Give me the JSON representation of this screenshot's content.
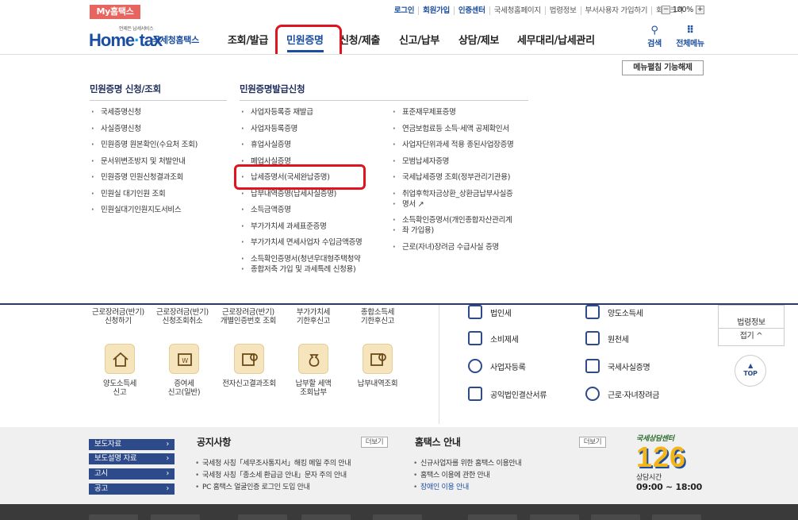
{
  "top": {
    "my_hometax": "My홈택스",
    "links": [
      "로그인",
      "회원가입",
      "인증센터",
      "국세청홈페이지",
      "법령정보",
      "부서사용자 가입하기",
      "화면크기"
    ],
    "zoom_minus": "−",
    "zoom_value": "100%",
    "zoom_plus": "+"
  },
  "logo": {
    "home": "Home",
    "tax": "tax",
    "korean": "국세청홈택스",
    "tiny": "언제든 납세서비스"
  },
  "gnb": {
    "items": [
      "조회/발급",
      "민원증명",
      "신청/제출",
      "신고/납부",
      "상담/제보",
      "세무대리/납세관리"
    ],
    "search": "검색",
    "all_menu": "전체메뉴"
  },
  "mega": {
    "fix_button": "메뉴펼침 기능해제",
    "col1_title": "민원증명 신청/조회",
    "col1_items": [
      "국세증명신청",
      "사실증명신청",
      "민원증명 원본확인(수요처 조회)",
      "문서위변조방지 및 처발안내",
      "민원증명 민원신청결과조회",
      "민원실 대기인원 조회",
      "민원실대기인원지도서비스"
    ],
    "col2_title": "민원증명발급신청",
    "col2_items": [
      "사업자등록증 재발급",
      "사업자등록증명",
      "휴업사실증명",
      "폐업사실증명",
      "납세증명서(국세완납증명)",
      "납부내역증명(납세사실증명)",
      "소득금액증명",
      "부가가치세 과세표준증명",
      "부가가치세 면세사업자 수입금액증명",
      "소득확인증명서(청년우대형주택청약",
      "종합저축 가입 및 과세특례 신청용)"
    ],
    "col3_items": [
      "표준재무제표증명",
      "연금보험료등 소득·세액 공제확인서",
      "사업자단위과세 적용 종된사업장증명",
      "모범납세자증명",
      "국세납세증명 조회(정부관리기관용)",
      "취업후학자금상환_상환금납부사실증",
      "명서",
      "소득확인증명서(개인종합자산관리계",
      "좌 가입용)",
      "근로(자녀)장려금 수급사실 증명"
    ]
  },
  "quick": {
    "row1": [
      "근로장려금(반기)",
      "신청하기",
      "근로장려금(반기)",
      "신청조회취소",
      "근로장려금(반기)",
      "개별인증번호 조회",
      "부가가치세",
      "기한후신고",
      "종합소득세",
      "기한후신고"
    ],
    "row2": [
      "양도소득세",
      "신고",
      "증여세",
      "신고(일반)",
      "전자신고결과조회",
      "납부할 세액",
      "조회납부",
      "납부내역조회"
    ]
  },
  "tax_menu": [
    "법인세",
    "양도소득세",
    "소비제세",
    "원천세",
    "사업자등록",
    "국세사실증명",
    "공익법인결산서류",
    "근로·자녀장려금"
  ],
  "rail": {
    "law": "법령정보",
    "fold": "접기 ^",
    "top": "TOP"
  },
  "bottom": {
    "tabs": [
      "보도자료",
      "보도설명 자료",
      "고시",
      "공고"
    ],
    "notice_title": "공지사항",
    "more": "더보기",
    "notices": [
      "국세청 사칭「세무조사통지서」해킹 메일 주의 안내",
      "국세청 사칭「종소세 환급금 안내」문자 주의 안내",
      "PC 홈택스 얼굴인증 로그인 도입 안내"
    ],
    "guide_title": "홈택스 안내",
    "guides": [
      "신규사업자를 위한 홈택스 이용안내",
      "홈택스 이용에 관한 안내",
      "장애인 이용 안내"
    ],
    "center_caption": "국세상담센터",
    "center_number": "126",
    "center_time_label": "상담시간",
    "center_time": "09:00 ~ 18:00"
  },
  "colors": {
    "brand": "#1b4ea0",
    "highlight": "#e0141e",
    "my_hometax": "#e8645f"
  }
}
